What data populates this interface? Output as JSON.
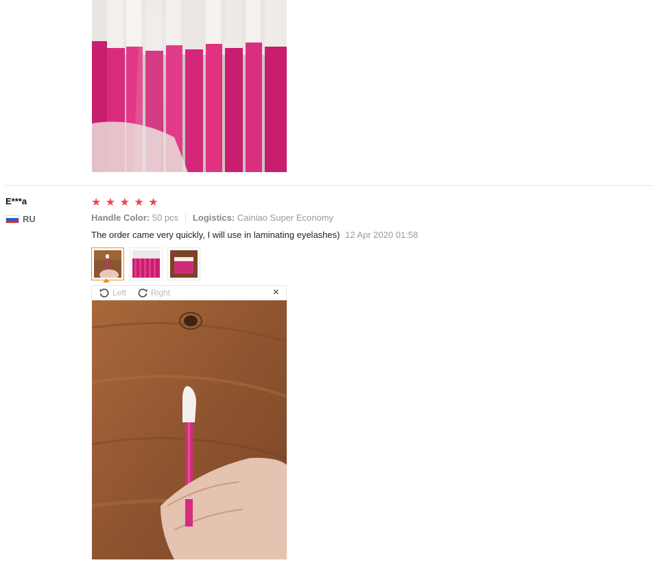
{
  "review": {
    "user_name": "E***a",
    "country": "RU",
    "rating_stars": [
      "★",
      "★",
      "★",
      "★",
      "★"
    ],
    "attributes": {
      "color_label": "Handle Color:",
      "color_value": "50 pcs",
      "logistics_label": "Logistics:",
      "logistics_value": "Cainiao Super Economy"
    },
    "text": "The order came very quickly, I will use in laminating eyelashes)",
    "date": "12 Apr 2020 01:58"
  },
  "viewer": {
    "rotate_left_label": "Left",
    "rotate_right_label": "Right",
    "close_glyph": "×"
  },
  "colors": {
    "star": "#f0444a",
    "accent": "#f08a2a",
    "muted": "#999999"
  },
  "icons": {
    "rotate_left": "rotate-left-icon",
    "rotate_right": "rotate-right-icon",
    "close": "close-icon",
    "flag": "russia-flag-icon"
  }
}
